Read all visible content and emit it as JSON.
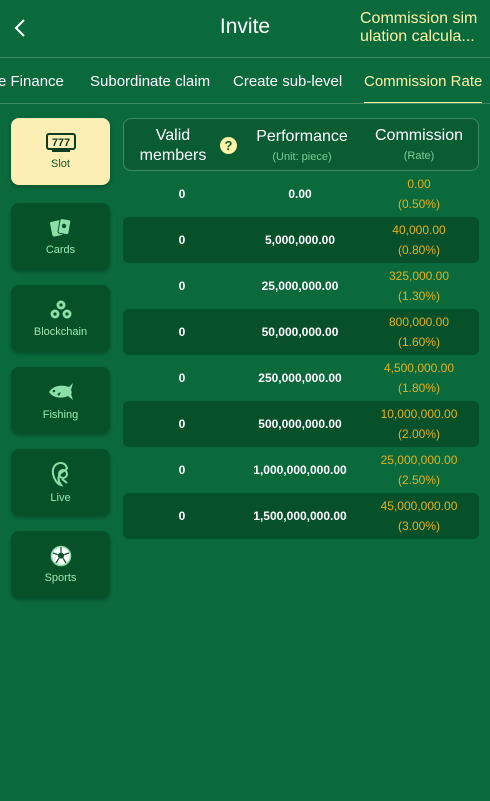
{
  "header": {
    "title": "Invite",
    "sim_link": "Commission simulation calcula..."
  },
  "tabs": [
    {
      "label": "e Finance"
    },
    {
      "label": "Subordinate claim"
    },
    {
      "label": "Create sub-level"
    },
    {
      "label": "Commission Rate",
      "active": true
    }
  ],
  "sidebar": {
    "items": [
      {
        "label": "Slot",
        "icon": "slot-777-icon",
        "active": true
      },
      {
        "label": "Cards",
        "icon": "cards-icon"
      },
      {
        "label": "Blockchain",
        "icon": "blockchain-icon"
      },
      {
        "label": "Fishing",
        "icon": "fishing-icon"
      },
      {
        "label": "Live",
        "icon": "live-icon"
      },
      {
        "label": "Sports",
        "icon": "sports-ball-icon"
      }
    ]
  },
  "table": {
    "headers": {
      "members": "Valid members",
      "performance": "Performance",
      "performance_sub": "(Unit: piece)",
      "commission": "Commission",
      "commission_sub": "(Rate)"
    },
    "rows": [
      {
        "members": "0",
        "performance": "0.00",
        "commission": "0.00",
        "rate": "(0.50%)"
      },
      {
        "members": "0",
        "performance": "5,000,000.00",
        "commission": "40,000.00",
        "rate": "(0.80%)"
      },
      {
        "members": "0",
        "performance": "25,000,000.00",
        "commission": "325,000.00",
        "rate": "(1.30%)"
      },
      {
        "members": "0",
        "performance": "50,000,000.00",
        "commission": "800,000.00",
        "rate": "(1.60%)"
      },
      {
        "members": "0",
        "performance": "250,000,000.00",
        "commission": "4,500,000.00",
        "rate": "(1.80%)"
      },
      {
        "members": "0",
        "performance": "500,000,000.00",
        "commission": "10,000,000.00",
        "rate": "(2.00%)"
      },
      {
        "members": "0",
        "performance": "1,000,000,000.00",
        "commission": "25,000,000.00",
        "rate": "(2.50%)"
      },
      {
        "members": "0",
        "performance": "1,500,000,000.00",
        "commission": "45,000,000.00",
        "rate": "(3.00%)"
      }
    ]
  },
  "colors": {
    "background": "#0a6a3c",
    "accent": "#fff3a6",
    "commission": "#e3b11f",
    "row_alt": "#06502a"
  }
}
